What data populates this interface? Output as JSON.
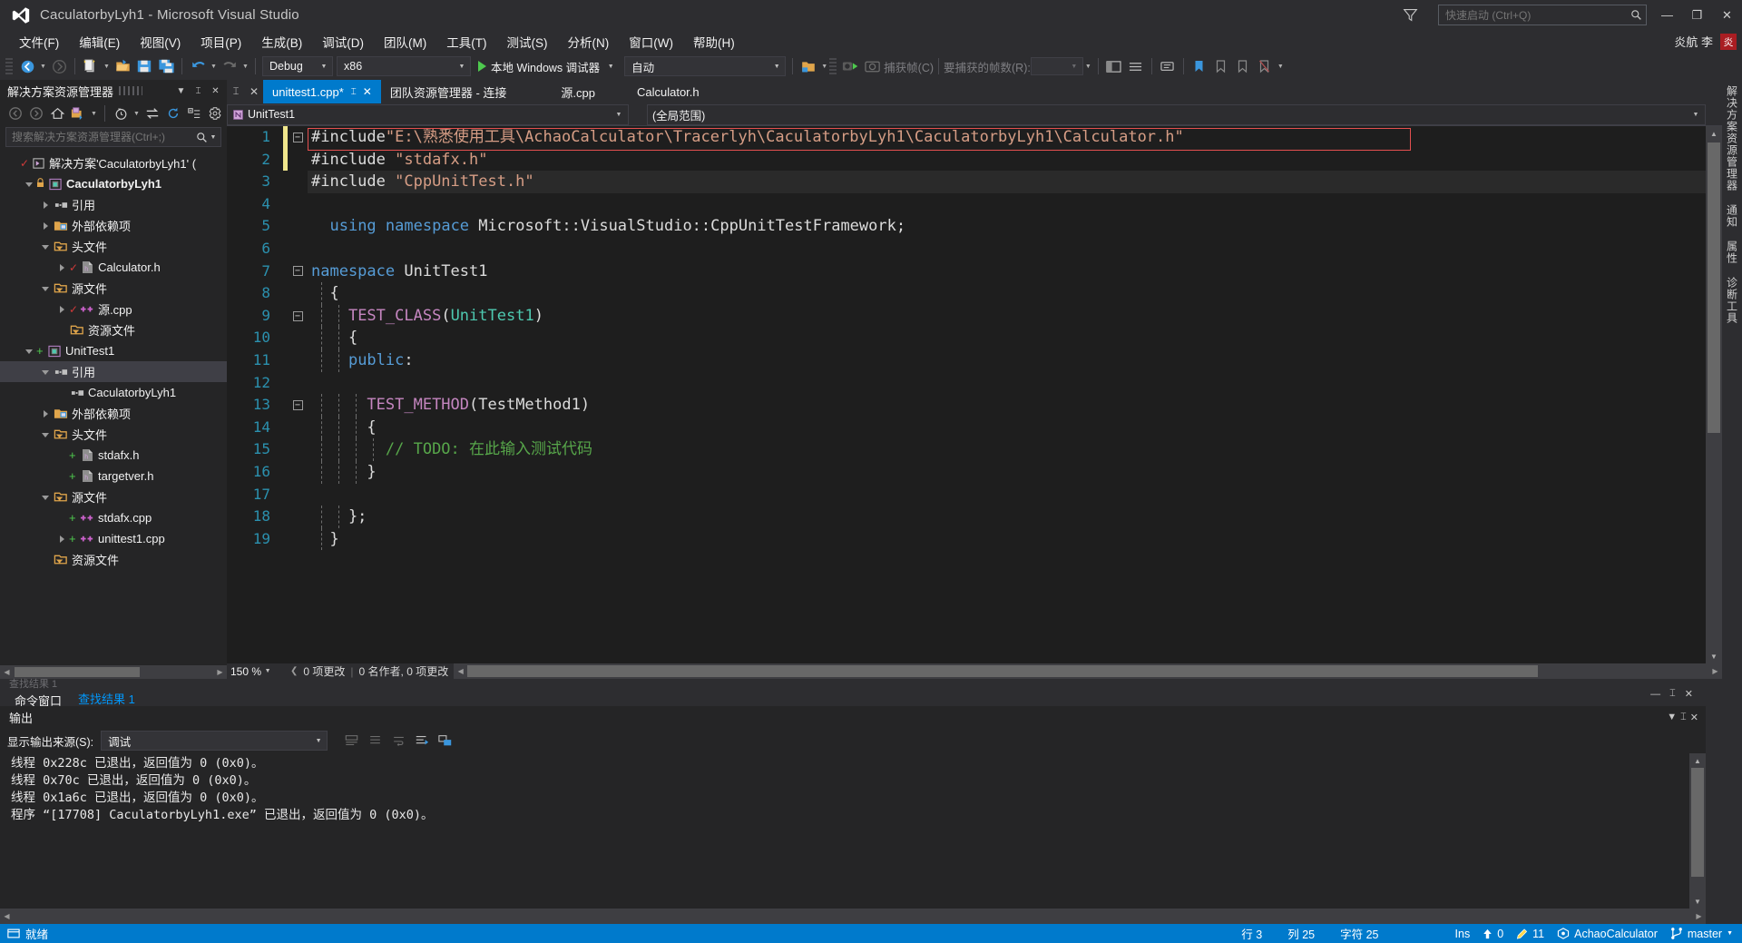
{
  "window": {
    "title": "CaculatorbyLyh1 - Microsoft Visual Studio",
    "logo_icon": "visual-studio-logo",
    "feedback_icon": "feedback-icon",
    "minimize_label": "—",
    "restore_label": "❐",
    "close_label": "✕"
  },
  "quick_launch": {
    "placeholder": "快速启动 (Ctrl+Q)",
    "value": "",
    "icon": "search-icon"
  },
  "user": {
    "name": "炎航 李",
    "avatar_initial": "炎"
  },
  "menu": {
    "items": [
      {
        "label": "文件(F)"
      },
      {
        "label": "编辑(E)"
      },
      {
        "label": "视图(V)"
      },
      {
        "label": "项目(P)"
      },
      {
        "label": "生成(B)"
      },
      {
        "label": "调试(D)"
      },
      {
        "label": "团队(M)"
      },
      {
        "label": "工具(T)"
      },
      {
        "label": "测试(S)"
      },
      {
        "label": "分析(N)"
      },
      {
        "label": "窗口(W)"
      },
      {
        "label": "帮助(H)"
      }
    ]
  },
  "toolbar": {
    "nav_back": "navigate-back",
    "nav_forward": "navigate-forward",
    "new_item": "new-item",
    "open_file": "open-file",
    "save": "save",
    "save_all": "save-all",
    "undo": "undo",
    "redo": "redo",
    "config_value": "Debug",
    "platform_value": "x86",
    "run_label": "本地 Windows 调试器",
    "attach_value": "自动",
    "folder_icon": "folder-icon",
    "camera_icon": "camera-play-icon",
    "capture_frame_label": "捕获帧(C)",
    "capture_count_label": "要捕获的帧数(R):",
    "capture_count_value": "",
    "extra_icons": [
      "window-layout",
      "line-numbers",
      "comment-block",
      "bookmark",
      "prev-bookmark",
      "next-bookmark",
      "more-options"
    ]
  },
  "solution_explorer": {
    "title": "解决方案资源管理器",
    "head_buttons": [
      "dropdown-icon",
      "pin-icon",
      "close-icon"
    ],
    "toolbar_icons": [
      "back-icon",
      "forward-icon",
      "home-icon",
      "switch-views-icon",
      "pending-changes-icon",
      "sync-icon",
      "refresh-icon",
      "collapse-all-icon",
      "properties-icon"
    ],
    "search_placeholder": "搜索解决方案资源管理器(Ctrl+;)",
    "search_value": "",
    "tree": [
      {
        "depth": 0,
        "twisty": "none",
        "icon": "solution-icon",
        "label": "解决方案'CaculatorbyLyh1' (",
        "bold": false,
        "check": true,
        "selected": false
      },
      {
        "depth": 1,
        "twisty": "open",
        "icon": "project-icon",
        "label": "CaculatorbyLyh1",
        "bold": true,
        "lock": true,
        "selected": false
      },
      {
        "depth": 2,
        "twisty": "closed",
        "icon": "references-icon",
        "label": "引用",
        "selected": false
      },
      {
        "depth": 2,
        "twisty": "closed",
        "icon": "ext-deps-icon",
        "label": "外部依赖项",
        "selected": false
      },
      {
        "depth": 2,
        "twisty": "open",
        "icon": "folder-filter-icon",
        "label": "头文件",
        "selected": false
      },
      {
        "depth": 3,
        "twisty": "closed",
        "icon": "header-file-icon",
        "label": "Calculator.h",
        "check": true,
        "selected": false
      },
      {
        "depth": 2,
        "twisty": "open",
        "icon": "folder-filter-icon",
        "label": "源文件",
        "selected": false
      },
      {
        "depth": 3,
        "twisty": "closed",
        "icon": "cpp-file-icon",
        "label": "源.cpp",
        "check": true,
        "selected": false
      },
      {
        "depth": 3,
        "twisty": "none",
        "icon": "folder-filter-icon",
        "label": "资源文件",
        "selected": false
      },
      {
        "depth": 1,
        "twisty": "open",
        "icon": "project-icon",
        "label": "UnitTest1",
        "plus": true,
        "selected": false
      },
      {
        "depth": 2,
        "twisty": "open",
        "icon": "references-icon",
        "label": "引用",
        "selected": true
      },
      {
        "depth": 3,
        "twisty": "none",
        "icon": "references-icon",
        "label": "CaculatorbyLyh1",
        "selected": false
      },
      {
        "depth": 2,
        "twisty": "closed",
        "icon": "ext-deps-icon",
        "label": "外部依赖项",
        "selected": false
      },
      {
        "depth": 2,
        "twisty": "open",
        "icon": "folder-filter-icon",
        "label": "头文件",
        "selected": false
      },
      {
        "depth": 3,
        "twisty": "none",
        "icon": "header-file-icon",
        "label": "stdafx.h",
        "plus": true,
        "selected": false
      },
      {
        "depth": 3,
        "twisty": "none",
        "icon": "header-file-icon",
        "label": "targetver.h",
        "plus": true,
        "selected": false
      },
      {
        "depth": 2,
        "twisty": "open",
        "icon": "folder-filter-icon",
        "label": "源文件",
        "selected": false
      },
      {
        "depth": 3,
        "twisty": "none",
        "icon": "cpp-file-icon",
        "label": "stdafx.cpp",
        "plus": true,
        "selected": false
      },
      {
        "depth": 3,
        "twisty": "closed",
        "icon": "cpp-file-icon",
        "label": "unittest1.cpp",
        "plus": true,
        "selected": false
      },
      {
        "depth": 2,
        "twisty": "none",
        "icon": "folder-filter-icon",
        "label": "资源文件",
        "selected": false
      }
    ]
  },
  "right_tabs": [
    {
      "label": "解决方案资源管理器"
    },
    {
      "label": "通知"
    },
    {
      "label": "属性"
    },
    {
      "label": "诊断工具"
    }
  ],
  "editor": {
    "tabs": [
      {
        "label": "unittest1.cpp*",
        "active": true,
        "pin": "⌶",
        "close": "✕"
      },
      {
        "label": "团队资源管理器 - 连接",
        "active": false
      },
      {
        "label": "源.cpp",
        "active": false
      },
      {
        "label": "Calculator.h",
        "active": false
      }
    ],
    "tabstrip_buttons": [
      "pin-tab-icon",
      "close-tab-icon"
    ],
    "nav_scope": "UnitTest1",
    "nav_member": "(全局范围)",
    "zoom": "150 %",
    "changes_info": "0 项更改",
    "authors_info": "0 名作者, 0 项更改",
    "code_lines": [
      {
        "n": 1,
        "fold": "minus",
        "changed": true,
        "error": true,
        "tokens": [
          {
            "t": "#include",
            "c": "pp"
          },
          {
            "t": "\"E:\\熟悉使用工具\\AchaoCalculator\\Tracerlyh\\CaculatorbyLyh1\\CaculatorbyLyh1\\Calculator.h\"",
            "c": "str"
          }
        ]
      },
      {
        "n": 2,
        "fold": "",
        "changed": true,
        "indent": 1,
        "tokens": [
          {
            "t": "#include ",
            "c": "pp"
          },
          {
            "t": "\"stdafx.h\"",
            "c": "str"
          }
        ]
      },
      {
        "n": 3,
        "fold": "",
        "changed": false,
        "indent": 1,
        "highlight": true,
        "tokens": [
          {
            "t": "#include ",
            "c": "pp"
          },
          {
            "t": "\"CppUnitTest.h\"",
            "c": "str"
          }
        ]
      },
      {
        "n": 4,
        "fold": "",
        "tokens": []
      },
      {
        "n": 5,
        "fold": "",
        "tokens": [
          {
            "t": "  ",
            "c": "pp"
          },
          {
            "t": "using",
            "c": "kw"
          },
          {
            "t": " ",
            "c": "pp"
          },
          {
            "t": "namespace",
            "c": "kw"
          },
          {
            "t": " Microsoft::VisualStudio::CppUnitTestFramework;",
            "c": "pp"
          }
        ]
      },
      {
        "n": 6,
        "fold": "",
        "tokens": []
      },
      {
        "n": 7,
        "fold": "minus",
        "tokens": [
          {
            "t": "namespace",
            "c": "kw"
          },
          {
            "t": " UnitTest1",
            "c": "pp"
          }
        ]
      },
      {
        "n": 8,
        "fold": "",
        "bars": [
          1
        ],
        "tokens": [
          {
            "t": "  {",
            "c": "pp"
          }
        ]
      },
      {
        "n": 9,
        "fold": "minus",
        "bars": [
          1,
          2
        ],
        "tokens": [
          {
            "t": "    ",
            "c": "pp"
          },
          {
            "t": "TEST_CLASS",
            "c": "mac"
          },
          {
            "t": "(",
            "c": "pp"
          },
          {
            "t": "UnitTest1",
            "c": "typ"
          },
          {
            "t": ")",
            "c": "pp"
          }
        ]
      },
      {
        "n": 10,
        "fold": "",
        "bars": [
          1,
          2
        ],
        "tokens": [
          {
            "t": "    {",
            "c": "pp"
          }
        ]
      },
      {
        "n": 11,
        "fold": "",
        "bars": [
          1,
          2
        ],
        "tokens": [
          {
            "t": "    ",
            "c": "pp"
          },
          {
            "t": "public",
            "c": "kw"
          },
          {
            "t": ":",
            "c": "pp"
          }
        ]
      },
      {
        "n": 12,
        "fold": "",
        "bars": [
          1,
          2,
          3
        ],
        "tokens": []
      },
      {
        "n": 13,
        "fold": "minus",
        "bars": [
          1,
          2,
          3
        ],
        "tokens": [
          {
            "t": "      ",
            "c": "pp"
          },
          {
            "t": "TEST_METHOD",
            "c": "mac"
          },
          {
            "t": "(TestMethod1)",
            "c": "pp"
          }
        ]
      },
      {
        "n": 14,
        "fold": "",
        "bars": [
          1,
          2,
          3
        ],
        "tokens": [
          {
            "t": "      {",
            "c": "pp"
          }
        ]
      },
      {
        "n": 15,
        "fold": "",
        "bars": [
          1,
          2,
          3,
          4
        ],
        "tokens": [
          {
            "t": "        ",
            "c": "pp"
          },
          {
            "t": "// TODO: 在此输入测试代码",
            "c": "cmt"
          }
        ]
      },
      {
        "n": 16,
        "fold": "",
        "bars": [
          1,
          2,
          3
        ],
        "tokens": [
          {
            "t": "      }",
            "c": "pp"
          }
        ]
      },
      {
        "n": 17,
        "fold": "",
        "bars": [
          1,
          2
        ],
        "tokens": []
      },
      {
        "n": 18,
        "fold": "",
        "bars": [
          1,
          2
        ],
        "tokens": [
          {
            "t": "    };",
            "c": "pp"
          }
        ]
      },
      {
        "n": 19,
        "fold": "",
        "bars": [
          1
        ],
        "tokens": [
          {
            "t": "  }",
            "c": "pp"
          }
        ]
      }
    ]
  },
  "bottom_dock": {
    "ghost_label": "查找结果 1",
    "tabs": [
      {
        "label": "命令窗口",
        "active": false
      },
      {
        "label": "查找结果 1",
        "active": true
      }
    ],
    "buttons": [
      "minimize-icon",
      "pin-icon",
      "close-icon"
    ]
  },
  "output_panel": {
    "title": "输出",
    "buttons": [
      "dropdown-icon",
      "pin-icon",
      "close-icon"
    ],
    "source_label": "显示输出来源(S):",
    "source_value": "调试",
    "toolbar_icons": [
      "find-message-icon",
      "clear-all-icon",
      "toggle-word-wrap-icon",
      "go-to-message-icon",
      "toggle-output-icon"
    ],
    "lines": [
      "线程 0x228c 已退出，返回值为 0 (0x0)。",
      "线程 0x70c 已退出，返回值为 0 (0x0)。",
      "线程 0x1a6c 已退出，返回值为 0 (0x0)。",
      "程序 “[17708] CaculatorbyLyh1.exe” 已退出，返回值为 0 (0x0)。"
    ]
  },
  "status_bar": {
    "state": "就绪",
    "state_icon": "ready-icon",
    "line_label": "行 3",
    "col_label": "列 25",
    "char_label": "字符 25",
    "ins_label": "Ins",
    "up_count": "0",
    "up_icon": "arrow-up-icon",
    "pencil_count": "11",
    "pencil_icon": "pencil-icon",
    "repo_name": "AchaoCalculator",
    "repo_icon": "source-control-icon",
    "branch_name": "master",
    "branch_icon": "branch-icon"
  },
  "colors": {
    "accent": "#007acc",
    "chrome": "#2d2d30",
    "panel": "#252526",
    "editor_bg": "#1e1e1e",
    "keyword": "#569cd6",
    "string": "#d69d85",
    "macro": "#c586c0",
    "type": "#4ec9b0",
    "comment": "#57a64a",
    "linenum": "#2b91af",
    "error": "#e45050",
    "changed": "#f0e68c"
  }
}
